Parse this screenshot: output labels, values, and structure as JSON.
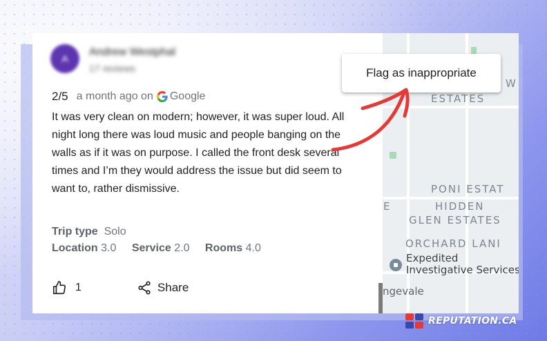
{
  "review": {
    "avatar_letter": "A",
    "author_name": "Andrew Westphal",
    "author_reviews": "17 reviews",
    "rating": "2/5",
    "time_ago": "a month ago on",
    "source": "Google",
    "text": "It was very clean on modern; however, it was super loud. All night long there was loud music and people banging on the walls as if it was on purpose. I called the front desk several times and I’m they would address the issue but did seem to want to, rather dismissive.",
    "trip_type_label": "Trip type",
    "trip_type_value": "Solo",
    "ratings": [
      {
        "label": "Location",
        "value": "3.0"
      },
      {
        "label": "Service",
        "value": "2.0"
      },
      {
        "label": "Rooms",
        "value": "4.0"
      }
    ],
    "like_count": "1",
    "share_label": "Share"
  },
  "menu": {
    "flag_label": "Flag as inappropriate"
  },
  "map": {
    "labels": [
      "W",
      "ESTATES",
      "PONI ESTAT",
      "E",
      "HIDDEN",
      "GLEN ESTATES",
      "ORCHARD LANI"
    ],
    "poi_line1": "Expedited",
    "poi_line2": "Investigative Services",
    "place": "ngevale"
  },
  "brand": {
    "name": "REPUTATION.CA"
  },
  "colors": {
    "avatar": "#5e35b1",
    "arrow": "#e53935",
    "map_bg": "#eceff1",
    "accent_bg": "#6f7be6"
  },
  "icons": {
    "like": "thumbs-up-icon",
    "share": "share-icon",
    "google": "google-g-icon",
    "poi": "building-pin-icon"
  }
}
